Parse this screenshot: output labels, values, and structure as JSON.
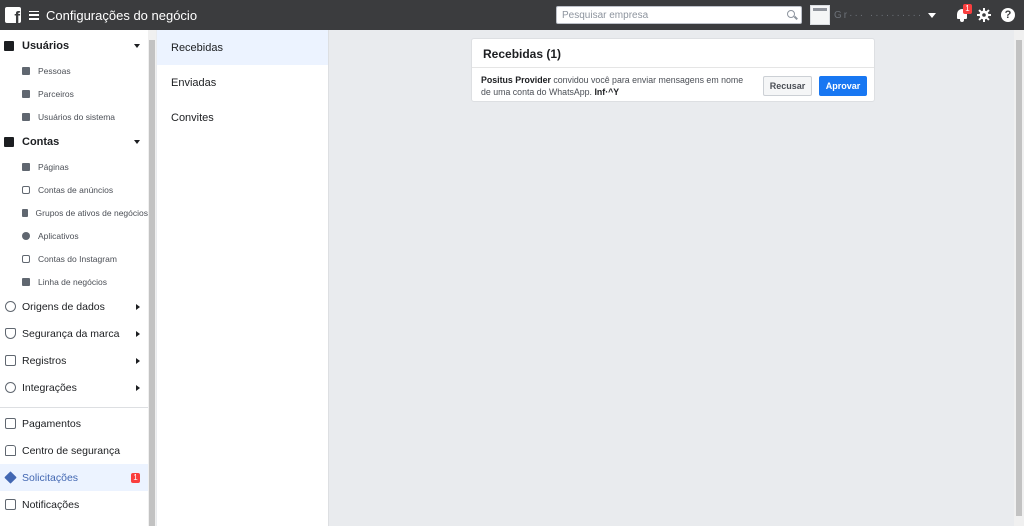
{
  "app": {
    "title": "Configurações do negócio",
    "logo_letter": "f"
  },
  "search": {
    "placeholder": "Pesquisar empresa"
  },
  "account": {
    "name": "Gr··· ··········· ·"
  },
  "notifications": {
    "badge": "1"
  },
  "help": {
    "label": "?"
  },
  "sidebar": {
    "users_header": "Usuários",
    "users_items": [
      "Pessoas",
      "Parceiros",
      "Usuários do sistema"
    ],
    "accounts_header": "Contas",
    "accounts_items": [
      "Páginas",
      "Contas de anúncios",
      "Grupos de ativos de negócios",
      "Aplicativos",
      "Contas do Instagram",
      "Linha de negócios"
    ],
    "main_items": [
      "Origens de dados",
      "Segurança da marca",
      "Registros",
      "Integrações"
    ],
    "bottom_items": [
      "Pagamentos",
      "Centro de segurança",
      "Solicitações",
      "Notificações"
    ],
    "requests_badge": "1"
  },
  "tabs": [
    "Recebidas",
    "Enviadas",
    "Convites"
  ],
  "card": {
    "title": "Recebidas (1)",
    "sender": "Positus Provider",
    "message": " convidou você para enviar mensagens em nome de uma conta do WhatsApp. ",
    "account_partial": "Inf·^Y",
    "decline_label": "Recusar",
    "approve_label": "Aprovar"
  },
  "colors": {
    "topbar": "#3b3c3e",
    "accent": "#1877f2",
    "badge": "#fa3e3e",
    "active_bg": "#ecf3ff",
    "active_text": "#4267b2"
  }
}
